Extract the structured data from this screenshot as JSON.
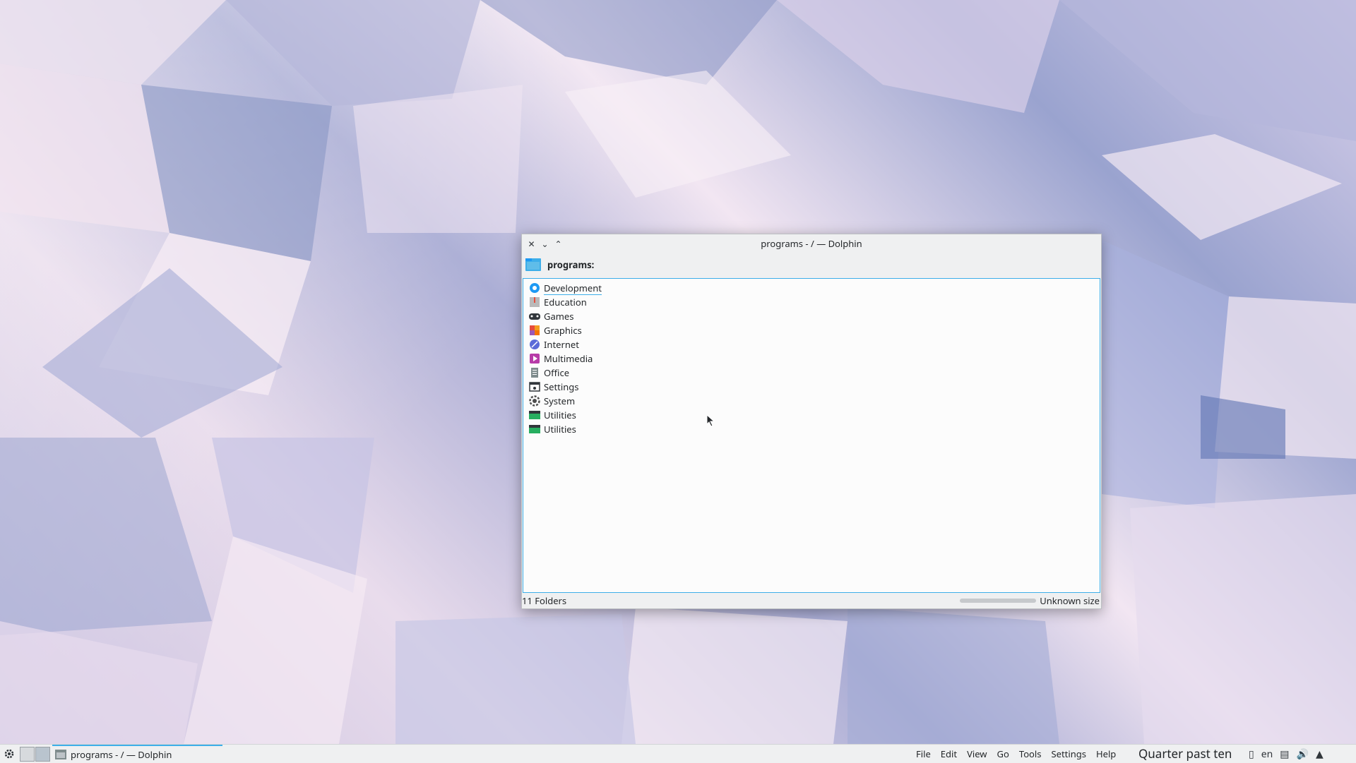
{
  "window": {
    "title": "programs - / — Dolphin",
    "location": "programs:",
    "buttons": {
      "close": "✕",
      "minimize": "⌄",
      "maximize": "⌃"
    }
  },
  "items": [
    {
      "label": "Development",
      "icon": "development-icon",
      "color": "#1d99f3"
    },
    {
      "label": "Education",
      "icon": "education-icon",
      "color": "#a0a0a0"
    },
    {
      "label": "Games",
      "icon": "games-icon",
      "color": "#31363b"
    },
    {
      "label": "Graphics",
      "icon": "graphics-icon",
      "color": "#e74c3c"
    },
    {
      "label": "Internet",
      "icon": "internet-icon",
      "color": "#5b6bd8"
    },
    {
      "label": "Multimedia",
      "icon": "multimedia-icon",
      "color": "#b73ba8"
    },
    {
      "label": "Office",
      "icon": "office-icon",
      "color": "#7f8c8d"
    },
    {
      "label": "Settings",
      "icon": "settings-icon",
      "color": "#31363b"
    },
    {
      "label": "System",
      "icon": "system-icon",
      "color": "#4d4d4d"
    },
    {
      "label": "Utilities",
      "icon": "utilities-icon",
      "color": "#27ae60"
    },
    {
      "label": "Utilities",
      "icon": "utilities-icon",
      "color": "#27ae60"
    }
  ],
  "status": {
    "folders": "11 Folders",
    "size": "Unknown size"
  },
  "taskbar": {
    "task_label": "programs - / — Dolphin",
    "menu": [
      "File",
      "Edit",
      "View",
      "Go",
      "Tools",
      "Settings",
      "Help"
    ],
    "clock": "Quarter past ten",
    "keyboard_layout": "en"
  },
  "colors": {
    "accent": "#3daee9",
    "window_bg": "#eff0f1",
    "view_bg": "#fcfcfc"
  }
}
